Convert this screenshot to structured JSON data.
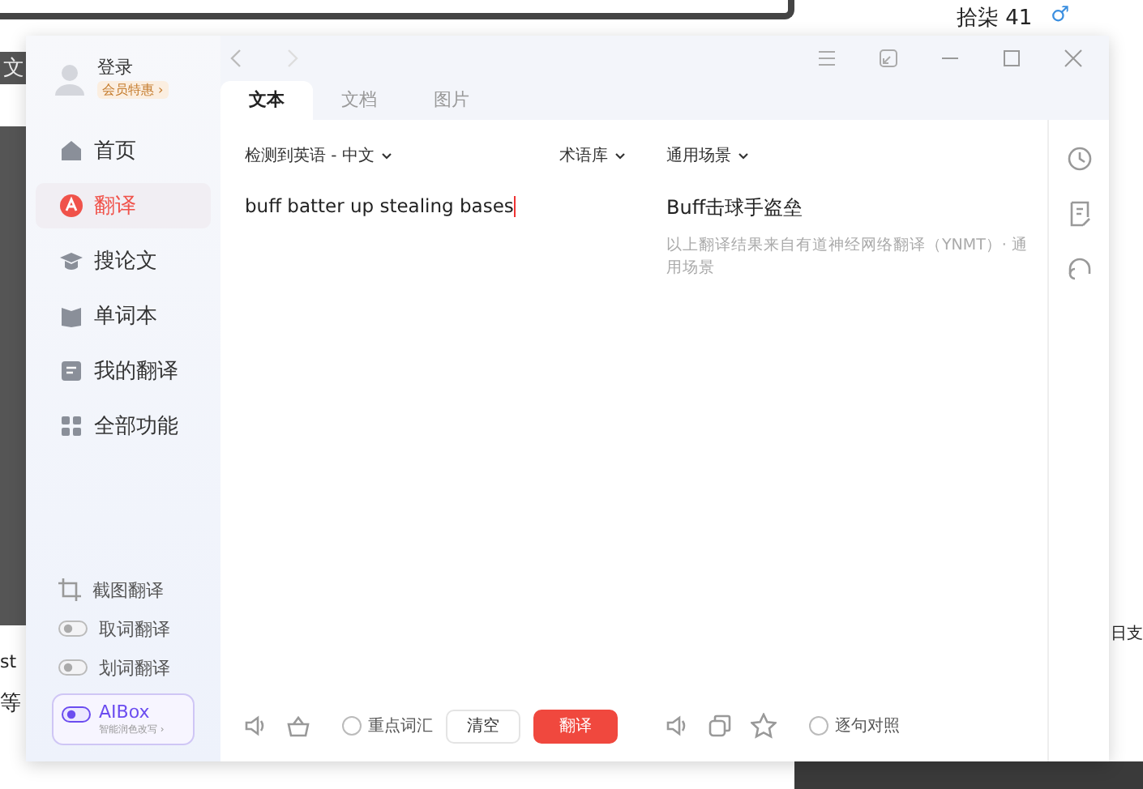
{
  "background": {
    "texts": [
      {
        "text": "拾柒 41"
      },
      {
        "text": "♂"
      },
      {
        "text": "文"
      },
      {
        "text": "st"
      },
      {
        "text": "等"
      },
      {
        "text": "日支"
      }
    ]
  },
  "account": {
    "login": "登录",
    "member": "会员特惠 ›"
  },
  "sidebar": {
    "items": [
      {
        "label": "首页",
        "selected": false
      },
      {
        "label": "翻译",
        "selected": true
      },
      {
        "label": "搜论文",
        "selected": false
      },
      {
        "label": "单词本",
        "selected": false
      },
      {
        "label": "我的翻译",
        "selected": false
      },
      {
        "label": "全部功能",
        "selected": false
      }
    ],
    "tools": [
      {
        "kind": "crop",
        "label": "截图翻译"
      },
      {
        "kind": "toggle",
        "label": "取词翻译",
        "on": false
      },
      {
        "kind": "toggle",
        "label": "划词翻译",
        "on": false
      }
    ],
    "aibox": {
      "label": "AIBox",
      "sub": "智能润色改写 ›",
      "on": true
    }
  },
  "tabs": [
    {
      "label": "文本",
      "selected": true
    },
    {
      "label": "文档",
      "selected": false
    },
    {
      "label": "图片",
      "selected": false
    }
  ],
  "source": {
    "language": "检测到英语 - 中文",
    "glossary": "术语库",
    "text": "buff batter up stealing bases",
    "key_vocab": {
      "label": "重点词汇",
      "checked": false
    },
    "clear": "清空",
    "translate": "翻译"
  },
  "target": {
    "scene": "通用场景",
    "text": "Buff击球手盗垒",
    "note": "以上翻译结果来自有道神经网络翻译（YNMT）· 通用场景",
    "compare": {
      "label": "逐句对照",
      "checked": false
    }
  }
}
